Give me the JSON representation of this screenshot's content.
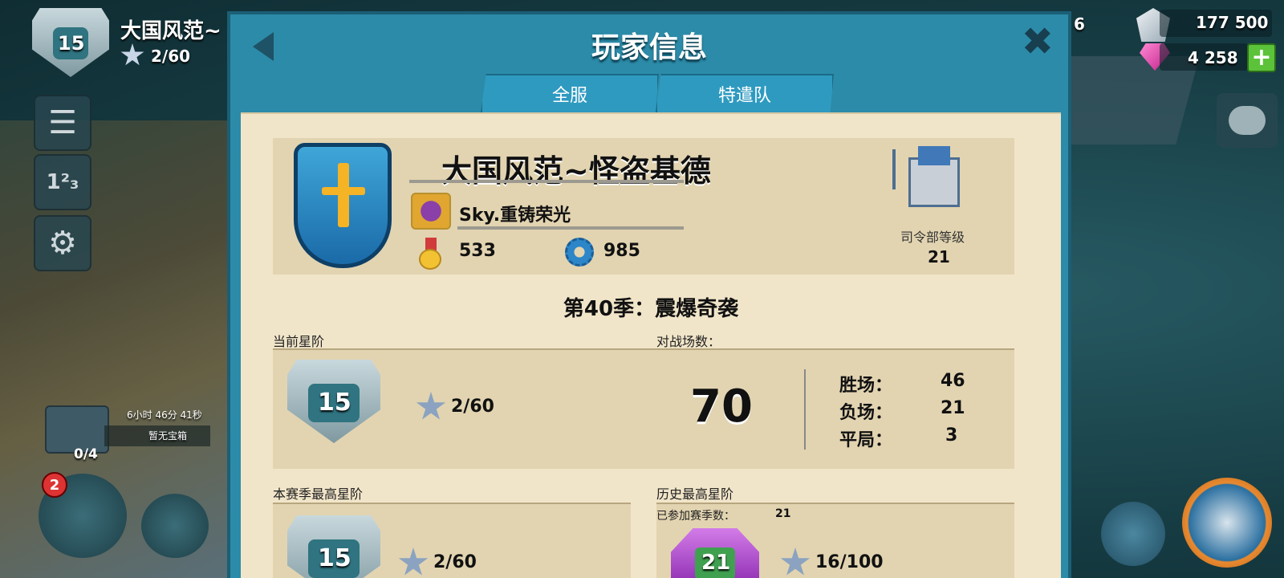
{
  "hud": {
    "player_level": "15",
    "player_name": "大国风范~",
    "stars": "2/60",
    "resource_partial": "6",
    "stone": "177 500",
    "gems": "4 258",
    "chest_timer": "6小时 46分 41秒",
    "chest_status": "暂无宝箱",
    "chest_count": "0/4",
    "notif_count": "2"
  },
  "panel": {
    "title": "玩家信息",
    "tabs": [
      "全服",
      "特遣队"
    ]
  },
  "profile": {
    "name": "大国风范~怪盗基德",
    "taskforce": "Sky.重铸荣光",
    "medals": "533",
    "parts": "985",
    "hq_label": "司令部等级",
    "hq_level": "21"
  },
  "season": {
    "title": "第40季：震爆奇袭",
    "current_rank_label": "当前星阶",
    "current_rank": "15",
    "current_stars": "2/60",
    "battles_label": "对战场数：",
    "battles_total": "70",
    "wins_label": "胜场：",
    "wins": "46",
    "losses_label": "负场：",
    "losses": "21",
    "draws_label": "平局：",
    "draws": "3",
    "season_best_label": "本赛季最高星阶",
    "season_best_rank": "15",
    "season_best_stars": "2/60",
    "all_time_label": "历史最高星阶",
    "seasons_joined_label": "已参加赛季数：",
    "seasons_joined": "21",
    "all_time_rank": "21",
    "all_time_stars": "16/100"
  },
  "colors": {
    "panel": "#2c8ba8",
    "paper": "#f1e5c9",
    "block": "#e2d4b1",
    "gem": "#e040a8",
    "plus": "#5cc23a"
  }
}
